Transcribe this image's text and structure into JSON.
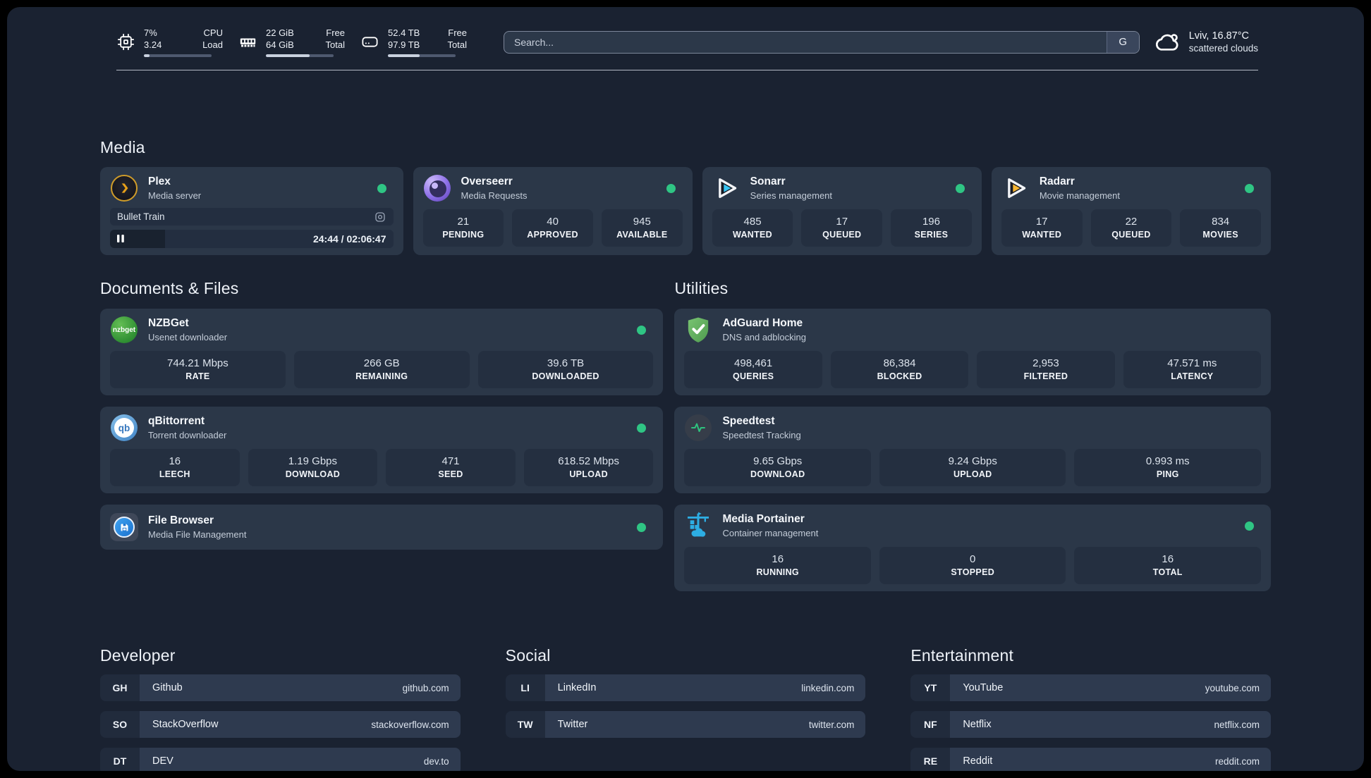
{
  "system": {
    "cpu": {
      "primary": "7%",
      "secondary": "3.24",
      "label_primary": "CPU",
      "label_secondary": "Load",
      "progress": 8
    },
    "memory": {
      "primary": "22 GiB",
      "secondary": "64 GiB",
      "label_primary": "Free",
      "label_secondary": "Total",
      "progress": 65
    },
    "disk": {
      "primary": "52.4 TB",
      "secondary": "97.9 TB",
      "label_primary": "Free",
      "label_secondary": "Total",
      "progress": 47
    }
  },
  "search": {
    "placeholder": "Search...",
    "button": "G"
  },
  "weather": {
    "location": "Lviv, 16.87°C",
    "condition": "scattered clouds"
  },
  "media": {
    "title": "Media",
    "cards": [
      {
        "name": "Plex",
        "subtitle": "Media server",
        "player": {
          "title": "Bullet Train",
          "time": "24:44 / 02:06:47",
          "progress": 19.5
        }
      },
      {
        "name": "Overseerr",
        "subtitle": "Media Requests",
        "stats": [
          {
            "value": "21",
            "label": "PENDING"
          },
          {
            "value": "40",
            "label": "APPROVED"
          },
          {
            "value": "945",
            "label": "AVAILABLE"
          }
        ]
      },
      {
        "name": "Sonarr",
        "subtitle": "Series management",
        "stats": [
          {
            "value": "485",
            "label": "WANTED"
          },
          {
            "value": "17",
            "label": "QUEUED"
          },
          {
            "value": "196",
            "label": "SERIES"
          }
        ]
      },
      {
        "name": "Radarr",
        "subtitle": "Movie management",
        "stats": [
          {
            "value": "17",
            "label": "WANTED"
          },
          {
            "value": "22",
            "label": "QUEUED"
          },
          {
            "value": "834",
            "label": "MOVIES"
          }
        ]
      }
    ]
  },
  "documents": {
    "title": "Documents & Files",
    "cards": [
      {
        "name": "NZBGet",
        "subtitle": "Usenet downloader",
        "icon_text": "nzbget",
        "stats": [
          {
            "value": "744.21 Mbps",
            "label": "RATE"
          },
          {
            "value": "266 GB",
            "label": "REMAINING"
          },
          {
            "value": "39.6 TB",
            "label": "DOWNLOADED"
          }
        ]
      },
      {
        "name": "qBittorrent",
        "subtitle": "Torrent downloader",
        "icon_text": "qb",
        "stats": [
          {
            "value": "16",
            "label": "LEECH"
          },
          {
            "value": "1.19 Gbps",
            "label": "DOWNLOAD"
          },
          {
            "value": "471",
            "label": "SEED"
          },
          {
            "value": "618.52 Mbps",
            "label": "UPLOAD"
          }
        ]
      },
      {
        "name": "File Browser",
        "subtitle": "Media File Management"
      }
    ]
  },
  "utilities": {
    "title": "Utilities",
    "cards": [
      {
        "name": "AdGuard Home",
        "subtitle": "DNS and adblocking",
        "stats": [
          {
            "value": "498,461",
            "label": "QUERIES"
          },
          {
            "value": "86,384",
            "label": "BLOCKED"
          },
          {
            "value": "2,953",
            "label": "FILTERED"
          },
          {
            "value": "47.571 ms",
            "label": "LATENCY"
          }
        ]
      },
      {
        "name": "Speedtest",
        "subtitle": "Speedtest Tracking",
        "stats": [
          {
            "value": "9.65 Gbps",
            "label": "DOWNLOAD"
          },
          {
            "value": "9.24 Gbps",
            "label": "UPLOAD"
          },
          {
            "value": "0.993 ms",
            "label": "PING"
          }
        ]
      },
      {
        "name": "Media Portainer",
        "subtitle": "Container management",
        "stats": [
          {
            "value": "16",
            "label": "RUNNING"
          },
          {
            "value": "0",
            "label": "STOPPED"
          },
          {
            "value": "16",
            "label": "TOTAL"
          }
        ]
      }
    ]
  },
  "bookmarks": [
    {
      "title": "Developer",
      "links": [
        {
          "abbr": "GH",
          "name": "Github",
          "host": "github.com"
        },
        {
          "abbr": "SO",
          "name": "StackOverflow",
          "host": "stackoverflow.com"
        },
        {
          "abbr": "DT",
          "name": "DEV",
          "host": "dev.to"
        }
      ]
    },
    {
      "title": "Social",
      "links": [
        {
          "abbr": "LI",
          "name": "LinkedIn",
          "host": "linkedin.com"
        },
        {
          "abbr": "TW",
          "name": "Twitter",
          "host": "twitter.com"
        }
      ]
    },
    {
      "title": "Entertainment",
      "links": [
        {
          "abbr": "YT",
          "name": "YouTube",
          "host": "youtube.com"
        },
        {
          "abbr": "NF",
          "name": "Netflix",
          "host": "netflix.com"
        },
        {
          "abbr": "RE",
          "name": "Reddit",
          "host": "reddit.com"
        }
      ]
    }
  ],
  "colors": {
    "background": "#1a2231",
    "card": "#2b3748",
    "tile": "#242f40",
    "status_online": "#2fc584",
    "plex_orange": "#e5a00d",
    "sonarr_blue": "#38c5f3",
    "radarr_yellow": "#f7b530",
    "portainer_blue": "#2daee4"
  }
}
